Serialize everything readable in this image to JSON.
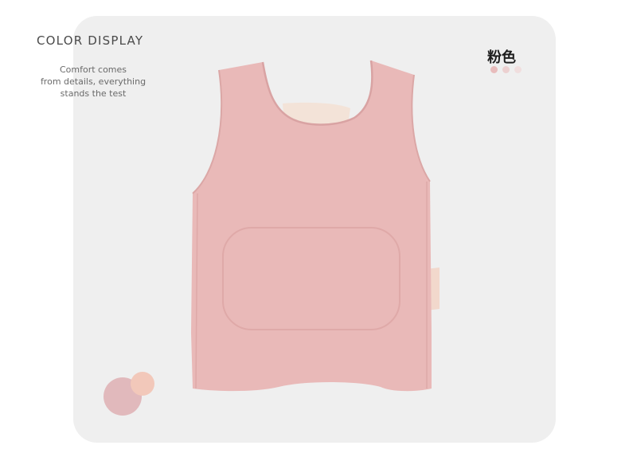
{
  "section": {
    "heading": "COLOR DISPLAY",
    "tagline": [
      "Comfort comes",
      "from details, everything",
      "stands the test"
    ]
  },
  "product": {
    "color_name": "粉色",
    "image_icon": "pink-vest-photo",
    "main_color": "#e9b9b8"
  },
  "color_dots": [
    {
      "color": "#e8bcbc"
    },
    {
      "color": "#ecd0d0"
    },
    {
      "color": "#f0dede"
    }
  ],
  "swatches": [
    {
      "color": "#e1b9bc"
    },
    {
      "color": "#f2c8ba"
    }
  ]
}
